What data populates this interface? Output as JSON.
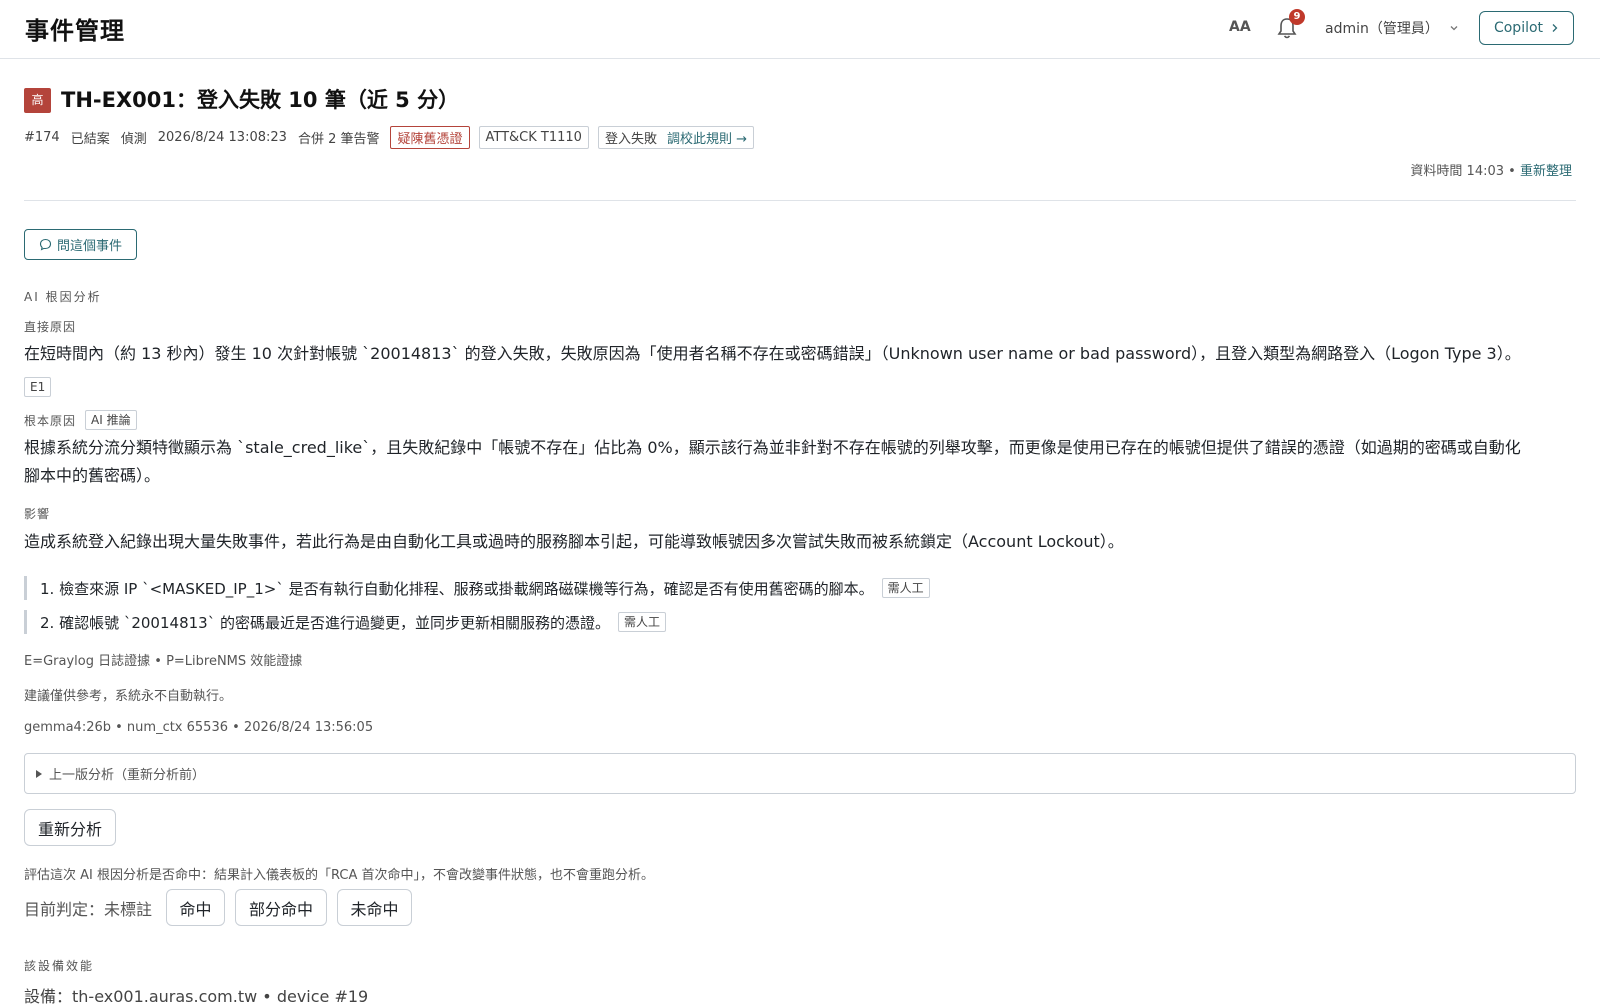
{
  "header": {
    "app_title": "事件管理",
    "font_size_toggle": "AA",
    "notifications_count": "9",
    "user_label": "admin（管理員）",
    "copilot_label": "Copilot"
  },
  "incident": {
    "severity": "高",
    "title": "TH-EX001：登入失敗 10 筆（近 5 分）",
    "id": "#174",
    "status": "已結案",
    "source": "偵測",
    "datetime": "2026/8/24 13:08:23",
    "merged": "合併 2 筆告警",
    "tags": {
      "stale_cred": "疑陳舊憑證",
      "attack": "ATT&CK T1110",
      "rule_name": "登入失敗",
      "rule_link": "調校此規則 →"
    },
    "data_time": "資料時間 14:03",
    "data_sep": "•",
    "refresh": "重新整理"
  },
  "ask_button": "問這個事件",
  "rca": {
    "section_label": "AI 根因分析",
    "direct_label": "直接原因",
    "direct_text": "在短時間內（約 13 秒內）發生 10 次針對帳號 `20014813` 的登入失敗，失敗原因為「使用者名稱不存在或密碼錯誤」（Unknown user name or bad password），且登入類型為網路登入（Logon Type 3）。",
    "direct_evidence": "E1",
    "root_label": "根本原因",
    "root_tag": "AI 推論",
    "root_text_1": "根據系統分流分類特徵顯示為 `stale_cred_like`，且失敗紀錄中「帳號不存在」佔比為 0%，顯示該行為並非針對不存在帳號的列舉攻擊，而更像是使用已存在的帳號但提供了錯誤的憑證（如過期的密碼或自動化",
    "root_text_2": "腳本中的舊密碼）。",
    "impact_label": "影響",
    "impact_text": "造成系統登入紀錄出現大量失敗事件，若此行為是由自動化工具或過時的服務腳本引起，可能導致帳號因多次嘗試失敗而被系統鎖定（Account Lockout）。",
    "steps": [
      {
        "text": "1. 檢查來源 IP `<MASKED_IP_1>` 是否有執行自動化排程、服務或掛載網路磁碟機等行為，確認是否有使用舊密碼的腳本。",
        "tag": "需人工"
      },
      {
        "text": "2. 確認帳號 `20014813` 的密碼最近是否進行過變更，並同步更新相關服務的憑證。",
        "tag": "需人工"
      }
    ],
    "legend": "E=Graylog 日誌證據 • P=LibreNMS 效能證據",
    "disclaimer": "建議僅供參考，系統永不自動執行。",
    "model_info": "gemma4:26b • num_ctx 65536 • 2026/8/24 13:56:05",
    "previous_version": "上一版分析（重新分析前）",
    "reanalyze": "重新分析",
    "evaluate_note": "評估這次 AI 根因分析是否命中：結果計入儀表板的「RCA 首次命中」，不會改變事件狀態，也不會重跑分析。",
    "verdict_label": "目前判定：未標註",
    "verdict_hit": "命中",
    "verdict_partial": "部分命中",
    "verdict_miss": "未命中"
  },
  "device": {
    "section_label": "該設備效能",
    "device_line": "設備：th-ex001.auras.com.tw • device #19"
  }
}
